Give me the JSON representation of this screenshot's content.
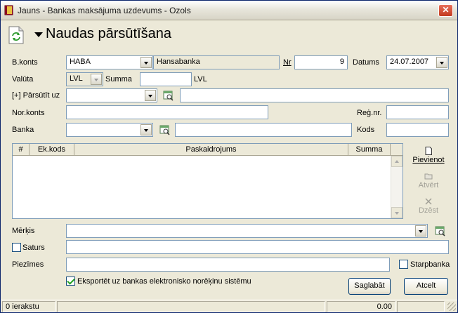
{
  "window": {
    "title": "Jauns - Bankas maksājuma uzdevums - Ozols",
    "close_glyph": "✕"
  },
  "header": {
    "title": "Naudas pārsūtīšana"
  },
  "form": {
    "bkonts_label": "B.konts",
    "bkonts_value": "HABA",
    "bank_name_value": "Hansabanka",
    "nr_label": "Nr",
    "nr_value": "9",
    "datums_label": "Datums",
    "datums_value": "24.07.2007",
    "valuta_label": "Valūta",
    "valuta_value": "LVL",
    "summa_label": "Summa",
    "summa_value": "",
    "summa_currency": "LVL",
    "parsutit_label": "[+] Pārsūtīt uz",
    "parsutit_value": "",
    "parsutit_name_value": "",
    "norkonts_label": "Nor.konts",
    "norkonts_value": "",
    "regnr_label": "Reģ.nr.",
    "regnr_value": "",
    "banka_label": "Banka",
    "banka_value": "",
    "banka_name_value": "",
    "kods_label": "Kods",
    "kods_value": "",
    "merkis_label": "Mērķis",
    "merkis_value": "",
    "saturs_label": "Saturs",
    "saturs_value": "",
    "piezimes_label": "Piezīmes",
    "piezimes_value": "",
    "starpbanka_label": "Starpbanka",
    "eksportet_label": "Eksportēt uz bankas elektronisko norēķinu sistēmu",
    "eksportet_checked": true,
    "saturs_checked": false,
    "starpbanka_checked": false
  },
  "grid": {
    "columns": [
      "#",
      "Ek.kods",
      "Paskaidrojums",
      "Summa"
    ],
    "rows": []
  },
  "side_buttons": {
    "pievienot": "Pievienot",
    "atvert": "Atvērt",
    "dzest": "Dzēst"
  },
  "buttons": {
    "save": "Saglabāt",
    "cancel": "Atcelt"
  },
  "status": {
    "count": "0 ierakstu",
    "total": "0.00"
  },
  "colors": {
    "title_close": "#c23a1f",
    "input_border": "#7f9db9",
    "window_bg": "#ece9d8"
  }
}
